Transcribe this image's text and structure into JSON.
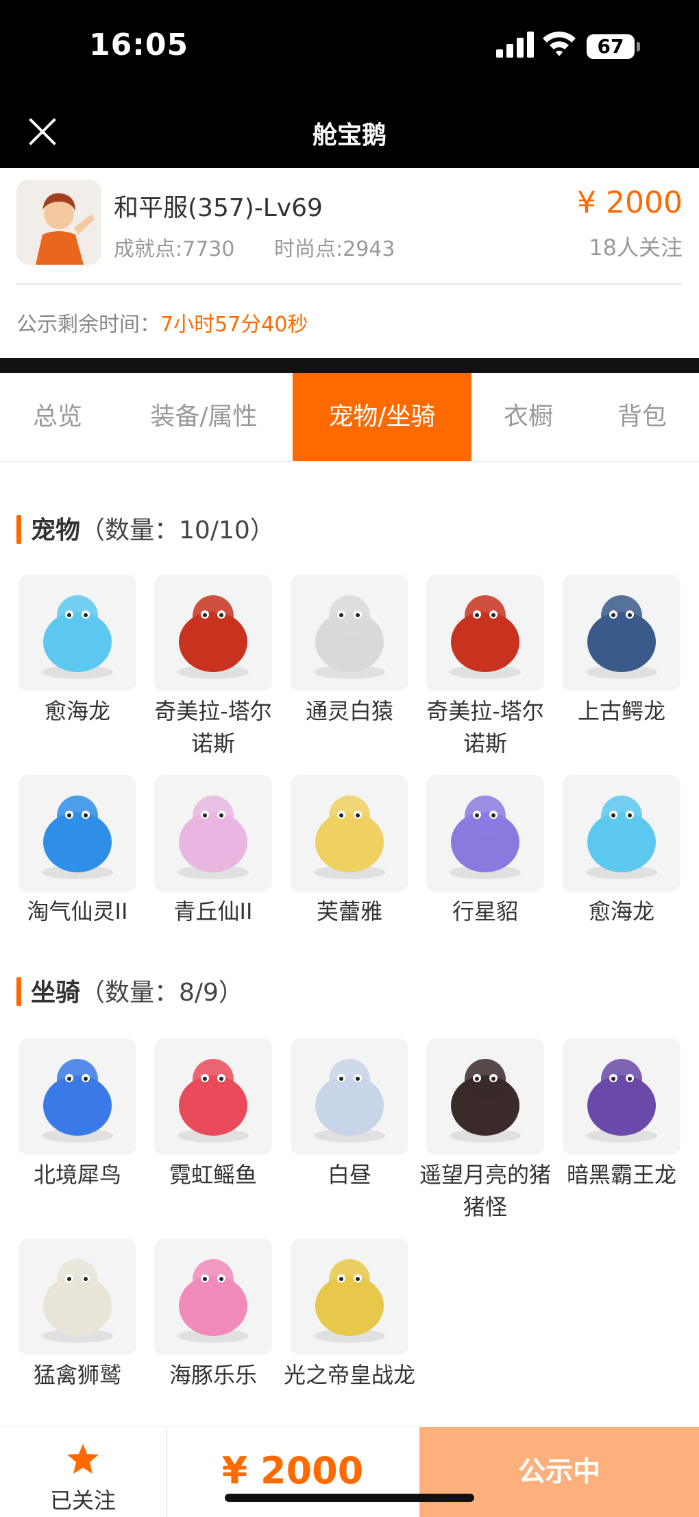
{
  "status_bar": {
    "time": "16:05",
    "battery": "67"
  },
  "nav": {
    "title": "舱宝鹅"
  },
  "account": {
    "name": "和平服(357)-Lv69",
    "price": "¥ 2000",
    "achievement": "成就点:7730",
    "fashion": "时尚点:2943",
    "followers": "18人关注",
    "remain_label": "公示剩余时间：",
    "remain_value": "7小时57分40秒"
  },
  "tabs": [
    {
      "label": "总览"
    },
    {
      "label": "装备/属性"
    },
    {
      "label": "宠物/坐骑",
      "active": true
    },
    {
      "label": "衣橱"
    },
    {
      "label": "背包"
    }
  ],
  "pets": {
    "title": "宠物",
    "count": "（数量：10/10）",
    "items": [
      {
        "label": "愈海龙",
        "icon": "ice-dragon-icon",
        "color": "#5cc8f0"
      },
      {
        "label": "奇美拉-塔尔诺斯",
        "icon": "chimera-icon",
        "color": "#c8321e"
      },
      {
        "label": "通灵白猿",
        "icon": "white-ape-icon",
        "color": "#d9d9d9"
      },
      {
        "label": "奇美拉-塔尔诺斯",
        "icon": "chimera-icon",
        "color": "#c8321e"
      },
      {
        "label": "上古鳄龙",
        "icon": "crocodile-dragon-icon",
        "color": "#3a5a8a"
      },
      {
        "label": "淘气仙灵II",
        "icon": "blue-puppy-icon",
        "color": "#2e8ee8"
      },
      {
        "label": "青丘仙II",
        "icon": "fox-fairy-icon",
        "color": "#e8b6e0"
      },
      {
        "label": "芙蕾雅",
        "icon": "goddess-icon",
        "color": "#f0d060"
      },
      {
        "label": "行星貂",
        "icon": "star-marten-icon",
        "color": "#8a7ae0"
      },
      {
        "label": "愈海龙",
        "icon": "ice-dragon-icon",
        "color": "#5cc8f0"
      }
    ]
  },
  "mounts": {
    "title": "坐骑",
    "count": "（数量：8/9）",
    "items": [
      {
        "label": "北境犀鸟",
        "icon": "hornbill-icon",
        "color": "#3a7ae8"
      },
      {
        "label": "霓虹鳐鱼",
        "icon": "ray-fish-icon",
        "color": "#e84a5a"
      },
      {
        "label": "白昼",
        "icon": "white-dragon-icon",
        "color": "#c8d4e8"
      },
      {
        "label": "遥望月亮的猪猪怪",
        "icon": "pig-monster-icon",
        "color": "#3a2a2a"
      },
      {
        "label": "暗黑霸王龙",
        "icon": "dark-trex-icon",
        "color": "#6a4aa8"
      },
      {
        "label": "猛禽狮鹫",
        "icon": "griffin-icon",
        "color": "#e8e4d8"
      },
      {
        "label": "海豚乐乐",
        "icon": "dolphin-icon",
        "color": "#f08ab8"
      },
      {
        "label": "光之帝皇战龙",
        "icon": "light-dragon-icon",
        "color": "#e8c84a"
      }
    ]
  },
  "bottom": {
    "follow_label": "已关注",
    "price": "¥ 2000",
    "status_button": "公示中"
  }
}
